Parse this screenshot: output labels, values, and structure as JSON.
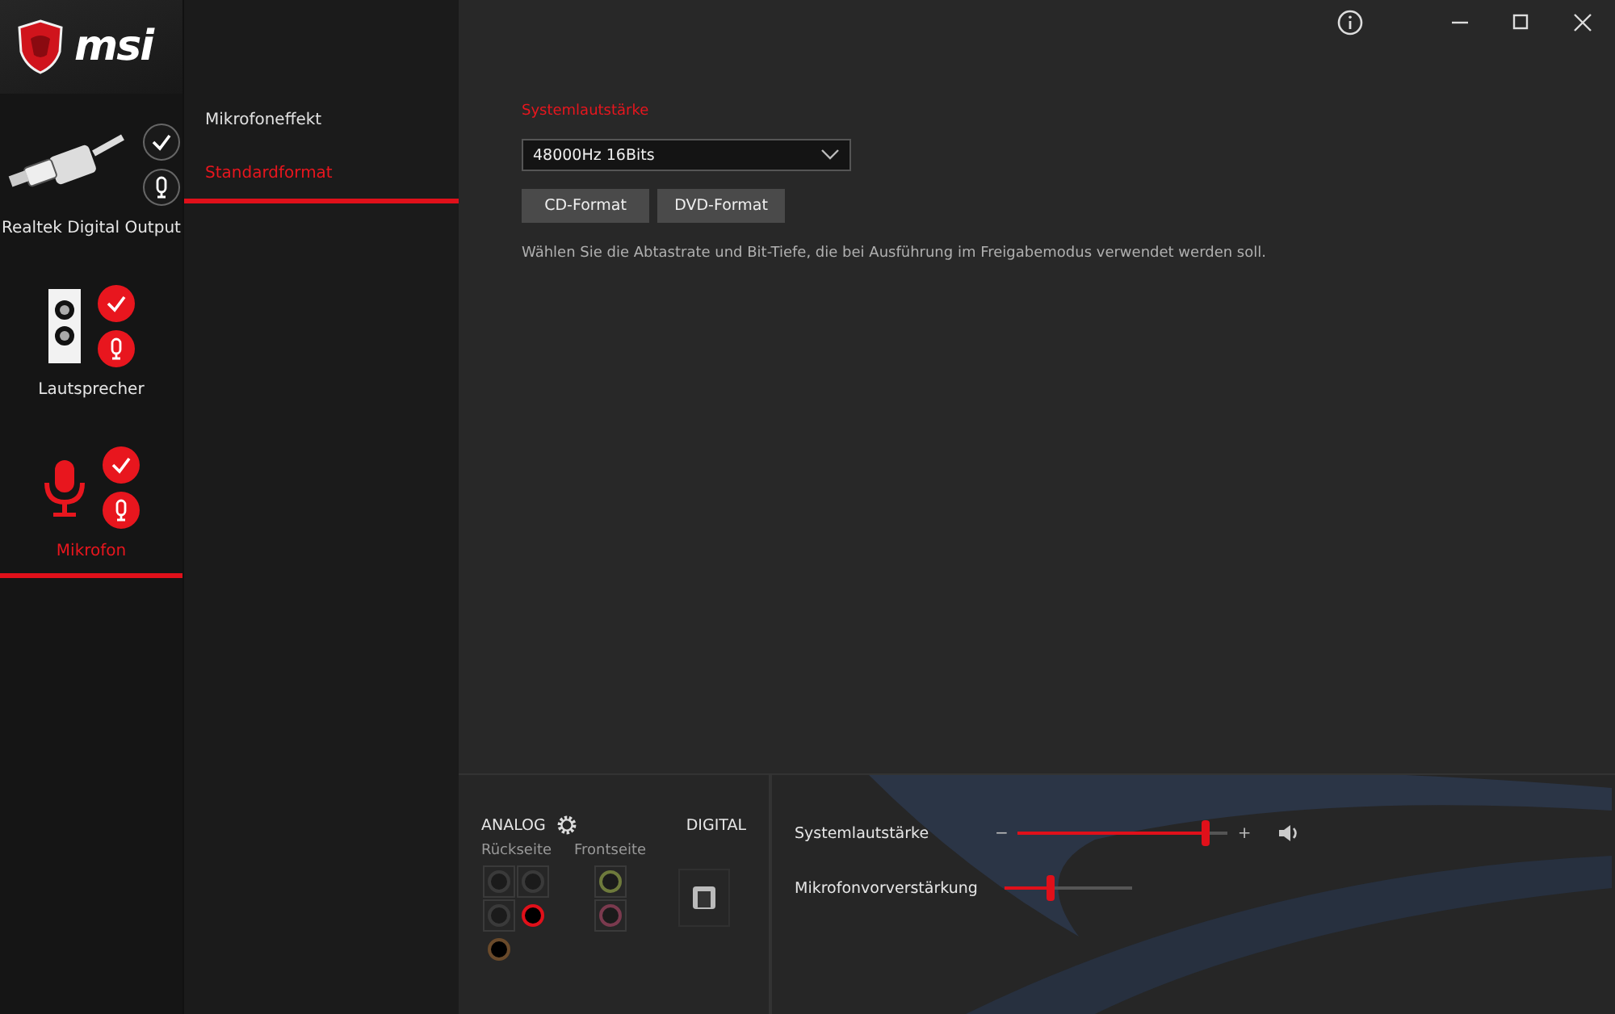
{
  "logo": {
    "text": "msi"
  },
  "devices": [
    {
      "name": "Realtek Digital Output",
      "kind": "plug",
      "selected": false,
      "enabled": false,
      "default_mic": false
    },
    {
      "name": "Lautsprecher",
      "kind": "speaker",
      "selected": false,
      "enabled": true,
      "default_mic": true
    },
    {
      "name": "Mikrofon",
      "kind": "mic",
      "selected": true,
      "enabled": true,
      "default_mic": true
    }
  ],
  "tabs": [
    {
      "label": "Mikrofoneffekt",
      "selected": false
    },
    {
      "label": "Standardformat",
      "selected": true
    }
  ],
  "format": {
    "heading": "Systemlautstärke",
    "value": "48000Hz 16Bits",
    "buttons": [
      "CD-Format",
      "DVD-Format"
    ],
    "description": "Wählen Sie die Abtastrate und Bit-Tiefe, die bei Ausführung im Freigabemodus verwendet werden soll."
  },
  "connectors": {
    "analog_label": "ANALOG",
    "digital_label": "DIGITAL",
    "rear_label": "Rückseite",
    "front_label": "Frontseite",
    "rear": [
      {
        "color": "#3a3a3a",
        "active": false
      },
      {
        "color": "#3a3a3a",
        "active": false
      },
      {
        "color": "#3a3a3a",
        "active": false
      },
      {
        "color": "#e0101a",
        "active": true
      },
      {
        "color": "#6a4a2a",
        "active": true
      }
    ],
    "front": [
      {
        "color": "#6e7a3c",
        "active": false
      },
      {
        "color": "#7a3a4e",
        "active": false
      }
    ]
  },
  "sliders": [
    {
      "label": "Systemlautstärke",
      "kind": "volume",
      "level": 0.89,
      "minus": "−",
      "plus": "+"
    },
    {
      "label": "Mikrofonvorverstärkung",
      "kind": "boost",
      "level": 0.35
    }
  ]
}
